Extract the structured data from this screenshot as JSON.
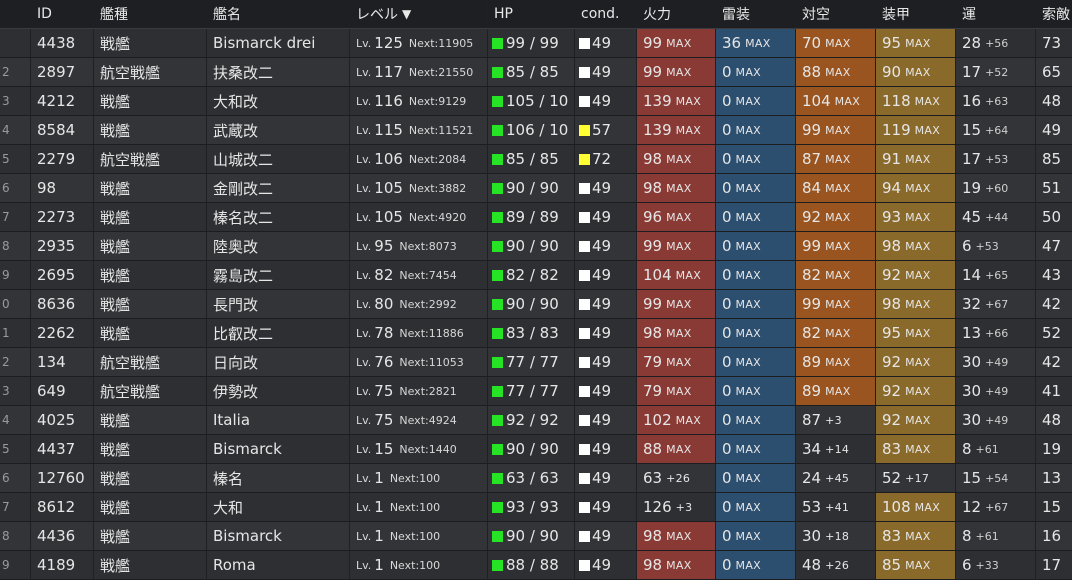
{
  "header": {
    "idx": "",
    "id": "ID",
    "type": "艦種",
    "name": "艦名",
    "level": "レベル",
    "hp": "HP",
    "cond": "cond.",
    "firepower": "火力",
    "torpedo": "雷装",
    "antiair": "対空",
    "armor": "装甲",
    "luck": "運",
    "los": "索敵"
  },
  "colors": {
    "hp_square": "#26e326",
    "cond_normal": "#ffffff",
    "cond_sparkle": "#ffff33"
  },
  "ships": [
    {
      "idx": "",
      "id": "4438",
      "type": "戦艦",
      "name": "Bismarck drei",
      "lv_prefix": "Lv.",
      "lv": "125",
      "next": "Next:11905",
      "hp": "99 / 99",
      "cond": "49",
      "cond_color": "#ffffff",
      "fp": "99",
      "fp_max": "MAX",
      "tp": "36",
      "tp_max": "MAX",
      "aa": "70",
      "aa_max": "MAX",
      "ar": "95",
      "ar_max": "MAX",
      "luck": "28",
      "luck_bonus": "+56",
      "los": "73"
    },
    {
      "idx": "2",
      "id": "2897",
      "type": "航空戦艦",
      "name": "扶桑改二",
      "lv_prefix": "Lv.",
      "lv": "117",
      "next": "Next:21550",
      "hp": "85 / 85",
      "cond": "49",
      "cond_color": "#ffffff",
      "fp": "99",
      "fp_max": "MAX",
      "tp": "0",
      "tp_max": "MAX",
      "aa": "88",
      "aa_max": "MAX",
      "ar": "90",
      "ar_max": "MAX",
      "luck": "17",
      "luck_bonus": "+52",
      "los": "65"
    },
    {
      "idx": "3",
      "id": "4212",
      "type": "戦艦",
      "name": "大和改",
      "lv_prefix": "Lv.",
      "lv": "116",
      "next": "Next:9129",
      "hp": "105 / 10",
      "cond": "49",
      "cond_color": "#ffffff",
      "fp": "139",
      "fp_max": "MAX",
      "tp": "0",
      "tp_max": "MAX",
      "aa": "104",
      "aa_max": "MAX",
      "ar": "118",
      "ar_max": "MAX",
      "luck": "16",
      "luck_bonus": "+63",
      "los": "48"
    },
    {
      "idx": "4",
      "id": "8584",
      "type": "戦艦",
      "name": "武蔵改",
      "lv_prefix": "Lv.",
      "lv": "115",
      "next": "Next:11521",
      "hp": "106 / 10",
      "cond": "57",
      "cond_color": "#ffff33",
      "fp": "139",
      "fp_max": "MAX",
      "tp": "0",
      "tp_max": "MAX",
      "aa": "99",
      "aa_max": "MAX",
      "ar": "119",
      "ar_max": "MAX",
      "luck": "15",
      "luck_bonus": "+64",
      "los": "49"
    },
    {
      "idx": "5",
      "id": "2279",
      "type": "航空戦艦",
      "name": "山城改二",
      "lv_prefix": "Lv.",
      "lv": "106",
      "next": "Next:2084",
      "hp": "85 / 85",
      "cond": "72",
      "cond_color": "#ffff33",
      "fp": "98",
      "fp_max": "MAX",
      "tp": "0",
      "tp_max": "MAX",
      "aa": "87",
      "aa_max": "MAX",
      "ar": "91",
      "ar_max": "MAX",
      "luck": "17",
      "luck_bonus": "+53",
      "los": "85"
    },
    {
      "idx": "6",
      "id": "98",
      "type": "戦艦",
      "name": "金剛改二",
      "lv_prefix": "Lv.",
      "lv": "105",
      "next": "Next:3882",
      "hp": "90 / 90",
      "cond": "49",
      "cond_color": "#ffffff",
      "fp": "98",
      "fp_max": "MAX",
      "tp": "0",
      "tp_max": "MAX",
      "aa": "84",
      "aa_max": "MAX",
      "ar": "94",
      "ar_max": "MAX",
      "luck": "19",
      "luck_bonus": "+60",
      "los": "51"
    },
    {
      "idx": "7",
      "id": "2273",
      "type": "戦艦",
      "name": "榛名改二",
      "lv_prefix": "Lv.",
      "lv": "105",
      "next": "Next:4920",
      "hp": "89 / 89",
      "cond": "49",
      "cond_color": "#ffffff",
      "fp": "96",
      "fp_max": "MAX",
      "tp": "0",
      "tp_max": "MAX",
      "aa": "92",
      "aa_max": "MAX",
      "ar": "93",
      "ar_max": "MAX",
      "luck": "45",
      "luck_bonus": "+44",
      "los": "50"
    },
    {
      "idx": "8",
      "id": "2935",
      "type": "戦艦",
      "name": "陸奥改",
      "lv_prefix": "Lv.",
      "lv": "95",
      "next": "Next:8073",
      "hp": "90 / 90",
      "cond": "49",
      "cond_color": "#ffffff",
      "fp": "99",
      "fp_max": "MAX",
      "tp": "0",
      "tp_max": "MAX",
      "aa": "99",
      "aa_max": "MAX",
      "ar": "98",
      "ar_max": "MAX",
      "luck": "6",
      "luck_bonus": "+53",
      "los": "47"
    },
    {
      "idx": "9",
      "id": "2695",
      "type": "戦艦",
      "name": "霧島改二",
      "lv_prefix": "Lv.",
      "lv": "82",
      "next": "Next:7454",
      "hp": "82 / 82",
      "cond": "49",
      "cond_color": "#ffffff",
      "fp": "104",
      "fp_max": "MAX",
      "tp": "0",
      "tp_max": "MAX",
      "aa": "82",
      "aa_max": "MAX",
      "ar": "92",
      "ar_max": "MAX",
      "luck": "14",
      "luck_bonus": "+65",
      "los": "43"
    },
    {
      "idx": "0",
      "id": "8636",
      "type": "戦艦",
      "name": "長門改",
      "lv_prefix": "Lv.",
      "lv": "80",
      "next": "Next:2992",
      "hp": "90 / 90",
      "cond": "49",
      "cond_color": "#ffffff",
      "fp": "99",
      "fp_max": "MAX",
      "tp": "0",
      "tp_max": "MAX",
      "aa": "99",
      "aa_max": "MAX",
      "ar": "98",
      "ar_max": "MAX",
      "luck": "32",
      "luck_bonus": "+67",
      "los": "42"
    },
    {
      "idx": "1",
      "id": "2262",
      "type": "戦艦",
      "name": "比叡改二",
      "lv_prefix": "Lv.",
      "lv": "78",
      "next": "Next:11886",
      "hp": "83 / 83",
      "cond": "49",
      "cond_color": "#ffffff",
      "fp": "98",
      "fp_max": "MAX",
      "tp": "0",
      "tp_max": "MAX",
      "aa": "82",
      "aa_max": "MAX",
      "ar": "95",
      "ar_max": "MAX",
      "luck": "13",
      "luck_bonus": "+66",
      "los": "52"
    },
    {
      "idx": "2",
      "id": "134",
      "type": "航空戦艦",
      "name": "日向改",
      "lv_prefix": "Lv.",
      "lv": "76",
      "next": "Next:11053",
      "hp": "77 / 77",
      "cond": "49",
      "cond_color": "#ffffff",
      "fp": "79",
      "fp_max": "MAX",
      "tp": "0",
      "tp_max": "MAX",
      "aa": "89",
      "aa_max": "MAX",
      "ar": "92",
      "ar_max": "MAX",
      "luck": "30",
      "luck_bonus": "+49",
      "los": "42"
    },
    {
      "idx": "3",
      "id": "649",
      "type": "航空戦艦",
      "name": "伊勢改",
      "lv_prefix": "Lv.",
      "lv": "75",
      "next": "Next:2821",
      "hp": "77 / 77",
      "cond": "49",
      "cond_color": "#ffffff",
      "fp": "79",
      "fp_max": "MAX",
      "tp": "0",
      "tp_max": "MAX",
      "aa": "89",
      "aa_max": "MAX",
      "ar": "92",
      "ar_max": "MAX",
      "luck": "30",
      "luck_bonus": "+49",
      "los": "41"
    },
    {
      "idx": "4",
      "id": "4025",
      "type": "戦艦",
      "name": "Italia",
      "lv_prefix": "Lv.",
      "lv": "75",
      "next": "Next:4924",
      "hp": "92 / 92",
      "cond": "49",
      "cond_color": "#ffffff",
      "fp": "102",
      "fp_max": "MAX",
      "tp": "0",
      "tp_max": "MAX",
      "aa": "87",
      "aa_max": "+3",
      "ar": "92",
      "ar_max": "MAX",
      "luck": "30",
      "luck_bonus": "+49",
      "los": "48"
    },
    {
      "idx": "5",
      "id": "4437",
      "type": "戦艦",
      "name": "Bismarck",
      "lv_prefix": "Lv.",
      "lv": "15",
      "next": "Next:1440",
      "hp": "90 / 90",
      "cond": "49",
      "cond_color": "#ffffff",
      "fp": "88",
      "fp_max": "MAX",
      "tp": "0",
      "tp_max": "MAX",
      "aa": "34",
      "aa_max": "+14",
      "ar": "83",
      "ar_max": "MAX",
      "luck": "8",
      "luck_bonus": "+61",
      "los": "19"
    },
    {
      "idx": "6",
      "id": "12760",
      "type": "戦艦",
      "name": "榛名",
      "lv_prefix": "Lv.",
      "lv": "1",
      "next": "Next:100",
      "hp": "63 / 63",
      "cond": "49",
      "cond_color": "#ffffff",
      "fp": "63",
      "fp_max": "+26",
      "tp": "0",
      "tp_max": "MAX",
      "aa": "24",
      "aa_max": "+45",
      "ar": "52",
      "ar_max": "+17",
      "luck": "15",
      "luck_bonus": "+54",
      "los": "13"
    },
    {
      "idx": "7",
      "id": "8612",
      "type": "戦艦",
      "name": "大和",
      "lv_prefix": "Lv.",
      "lv": "1",
      "next": "Next:100",
      "hp": "93 / 93",
      "cond": "49",
      "cond_color": "#ffffff",
      "fp": "126",
      "fp_max": "+3",
      "tp": "0",
      "tp_max": "MAX",
      "aa": "53",
      "aa_max": "+41",
      "ar": "108",
      "ar_max": "MAX",
      "luck": "12",
      "luck_bonus": "+67",
      "los": "15"
    },
    {
      "idx": "8",
      "id": "4436",
      "type": "戦艦",
      "name": "Bismarck",
      "lv_prefix": "Lv.",
      "lv": "1",
      "next": "Next:100",
      "hp": "90 / 90",
      "cond": "49",
      "cond_color": "#ffffff",
      "fp": "98",
      "fp_max": "MAX",
      "tp": "0",
      "tp_max": "MAX",
      "aa": "30",
      "aa_max": "+18",
      "ar": "83",
      "ar_max": "MAX",
      "luck": "8",
      "luck_bonus": "+61",
      "los": "16"
    },
    {
      "idx": "9",
      "id": "4189",
      "type": "戦艦",
      "name": "Roma",
      "lv_prefix": "Lv.",
      "lv": "1",
      "next": "Next:100",
      "hp": "88 / 88",
      "cond": "49",
      "cond_color": "#ffffff",
      "fp": "98",
      "fp_max": "MAX",
      "tp": "0",
      "tp_max": "MAX",
      "aa": "48",
      "aa_max": "+26",
      "ar": "85",
      "ar_max": "MAX",
      "luck": "6",
      "luck_bonus": "+33",
      "los": "17"
    }
  ]
}
